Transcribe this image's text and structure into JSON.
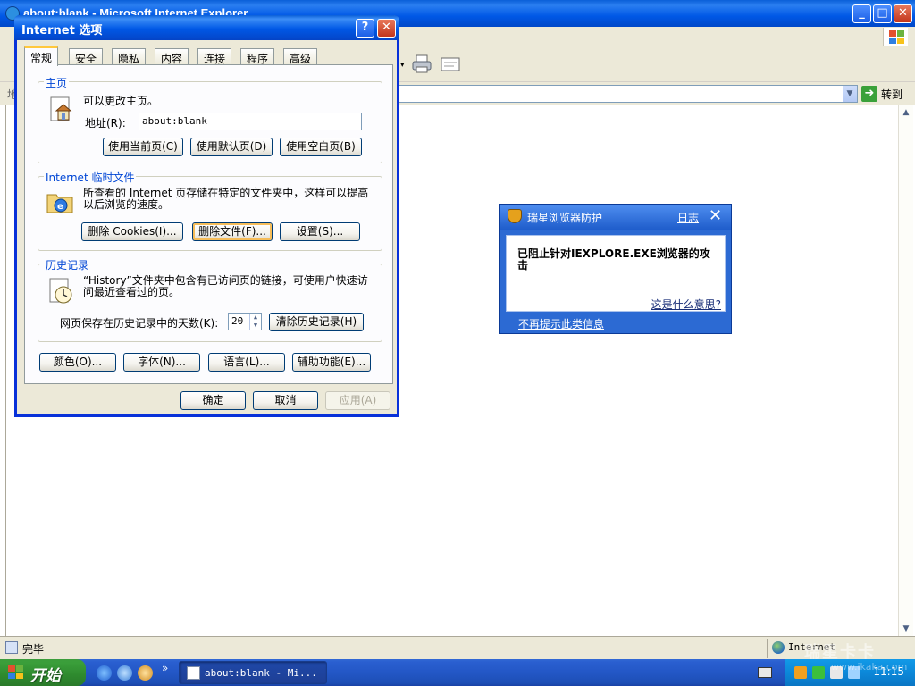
{
  "ie": {
    "title": "about:blank - Microsoft Internet Explorer",
    "address_label": "地址",
    "go_label": "转到",
    "status_text": "完毕",
    "zone_text": "Internet"
  },
  "dialog": {
    "title": "Internet 选项",
    "help_glyph": "?",
    "close_glyph": "✕",
    "tabs": [
      "常规",
      "安全",
      "隐私",
      "内容",
      "连接",
      "程序",
      "高级"
    ],
    "home": {
      "title": "主页",
      "desc": "可以更改主页。",
      "address_label": "地址(R):",
      "address_value": "about:blank",
      "btn_current": "使用当前页(C)",
      "btn_default": "使用默认页(D)",
      "btn_blank": "使用空白页(B)"
    },
    "temp": {
      "title": "Internet 临时文件",
      "desc": "所查看的 Internet 页存储在特定的文件夹中，这样可以提高以后浏览的速度。",
      "btn_cookies": "删除 Cookies(I)...",
      "btn_files": "删除文件(F)...",
      "btn_settings": "设置(S)..."
    },
    "history": {
      "title": "历史记录",
      "desc": "“History”文件夹中包含有已访问页的链接，可使用户快速访问最近查看过的页。",
      "days_label": "网页保存在历史记录中的天数(K):",
      "days_value": "20",
      "btn_clear": "清除历史记录(H)"
    },
    "bottom": {
      "btn_colors": "颜色(O)...",
      "btn_fonts": "字体(N)...",
      "btn_languages": "语言(L)...",
      "btn_accessibility": "辅助功能(E)..."
    },
    "footer": {
      "btn_ok": "确定",
      "btn_cancel": "取消",
      "btn_apply": "应用(A)"
    }
  },
  "rising": {
    "title": "瑞星浏览器防护",
    "log_link": "日志",
    "close_glyph": "✕",
    "message": "已阻止针对IEXPLORE.EXE浏览器的攻击",
    "what_link": "这是什么意思?",
    "no_more_link": "不再提示此类信息"
  },
  "taskbar": {
    "start_label": "开始",
    "more_glyph": "»",
    "task_label": "about:blank - Mi...",
    "clock": "11:15"
  },
  "watermark": {
    "brand": "瑞星卡卡",
    "url": "www.ikaka.com"
  },
  "colors": {
    "xp_title_blue": "#0058e6",
    "xp_start_green": "#3a9e3a",
    "dialog_face": "#ece9d8",
    "group_title": "#0046d5",
    "rising_blue": "#2c6ad3"
  }
}
